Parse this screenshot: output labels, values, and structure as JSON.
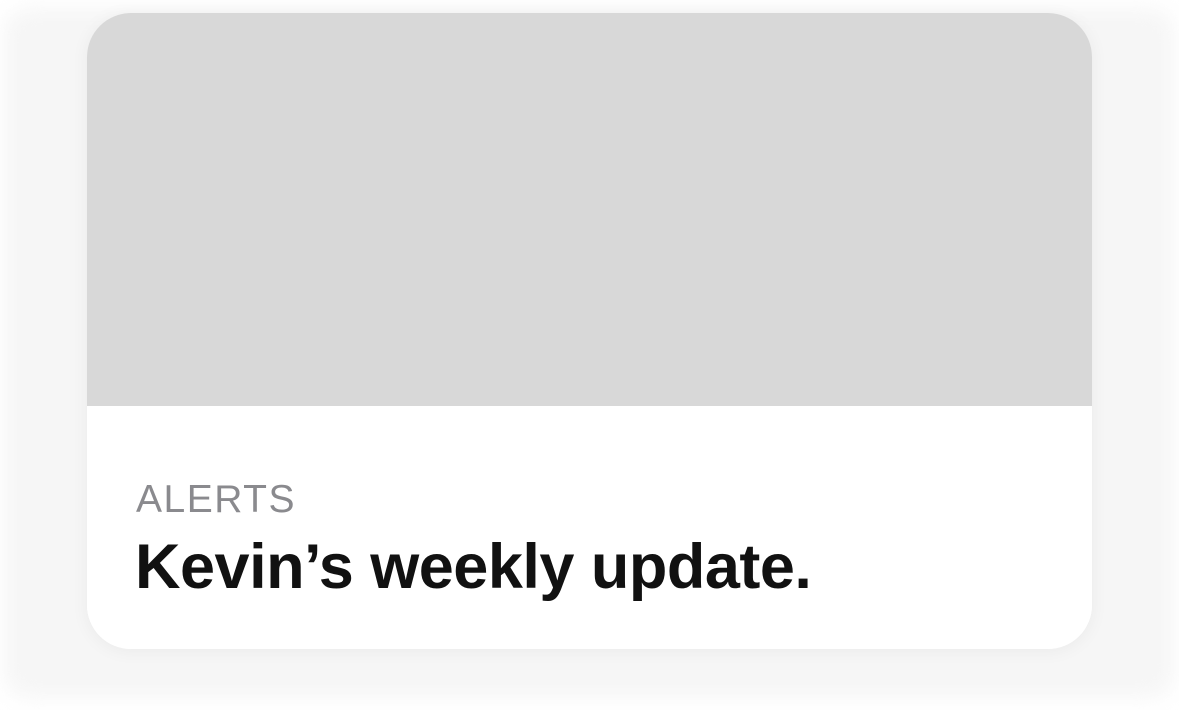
{
  "card": {
    "eyebrow": "ALERTS",
    "title": "Kevin’s weekly update."
  },
  "colors": {
    "image_placeholder": "#d8d8d8",
    "eyebrow": "#8a8a8e",
    "title": "#111111"
  }
}
